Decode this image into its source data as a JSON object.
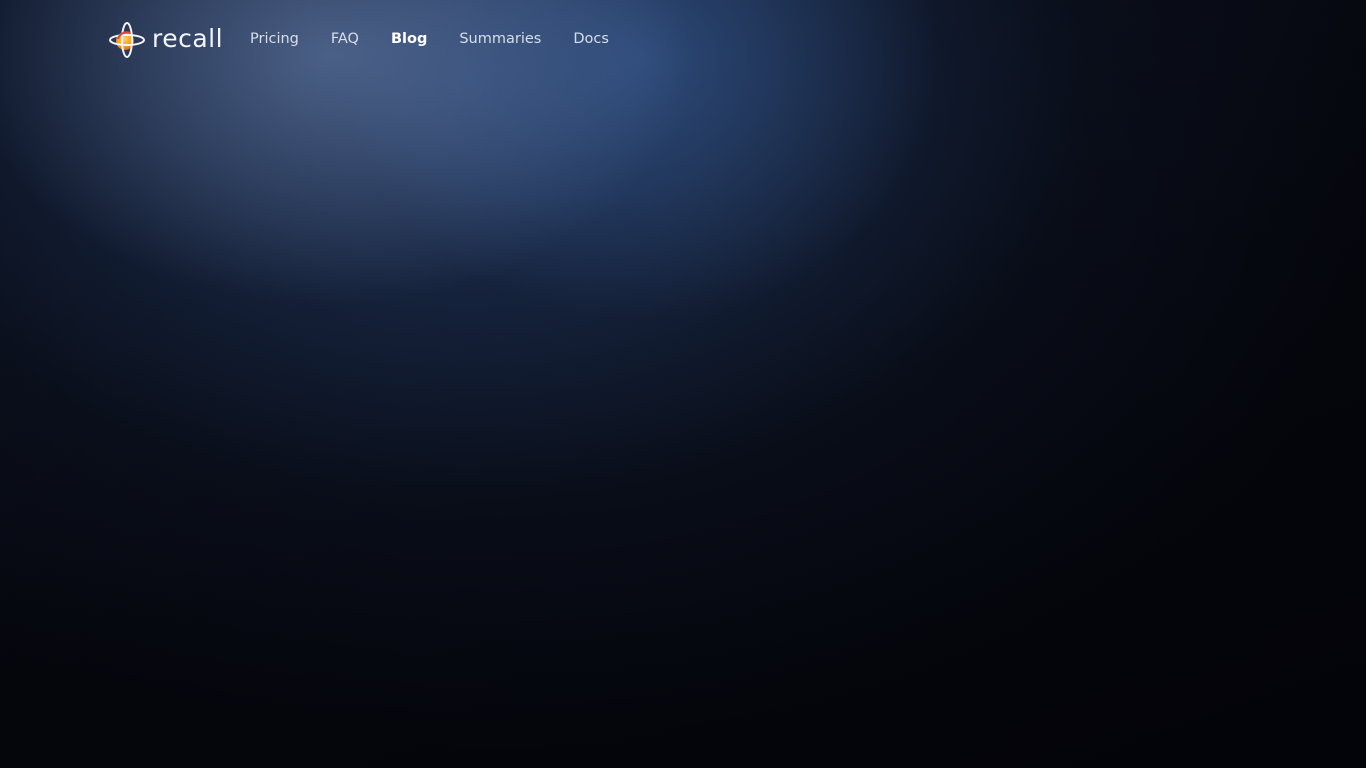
{
  "brand": {
    "name": "recall",
    "logo_icon": "recall-orbit-logo-icon",
    "accent_color": "#f5a623"
  },
  "nav": {
    "items": [
      {
        "label": "Pricing",
        "active": false
      },
      {
        "label": "FAQ",
        "active": false
      },
      {
        "label": "Blog",
        "active": true
      },
      {
        "label": "Summaries",
        "active": false
      },
      {
        "label": "Docs",
        "active": false
      }
    ]
  },
  "colors": {
    "background": "#05060c",
    "glow": "#3c64a0",
    "nav_text": "#d8deea"
  }
}
